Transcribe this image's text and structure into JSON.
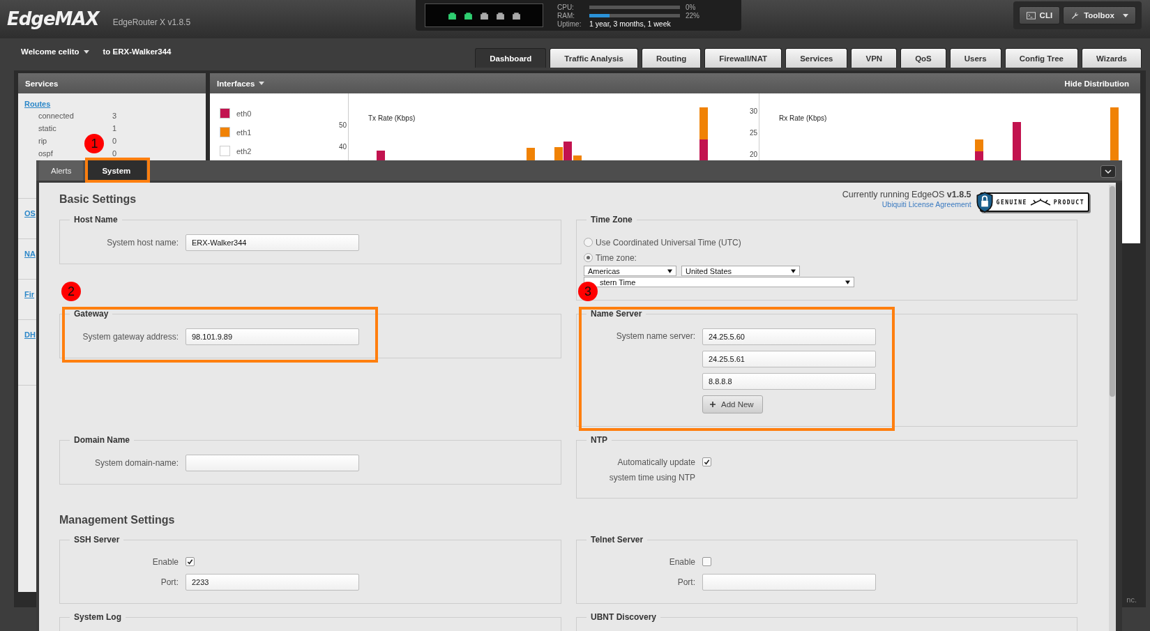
{
  "header": {
    "logo": "EdgeMAX",
    "model": "EdgeRouter X v1.8.5",
    "ports": [
      {
        "active": true
      },
      {
        "active": true
      },
      {
        "active": false
      },
      {
        "active": false
      },
      {
        "active": false
      }
    ],
    "meters": [
      {
        "label": "CPU:",
        "level": 0,
        "reading": "0%"
      },
      {
        "label": "RAM:",
        "level": 0.22,
        "reading": "22%"
      }
    ],
    "uptime": {
      "label": "Uptime:",
      "value": "1 year, 3 months, 1 week"
    },
    "buttons": [
      {
        "label": "CLI",
        "kind": "terminal"
      },
      {
        "label": "Toolbox",
        "kind": "wrench"
      }
    ]
  },
  "user": {
    "welcome": "Welcome celito",
    "target": "to ERX-Walker344"
  },
  "nav_tabs": [
    {
      "label": "Dashboard",
      "selected": true
    },
    {
      "label": "Traffic Analysis",
      "selected": false
    },
    {
      "label": "Routing",
      "selected": false
    },
    {
      "label": "Firewall/NAT",
      "selected": false
    },
    {
      "label": "Services",
      "selected": false
    },
    {
      "label": "VPN",
      "selected": false
    },
    {
      "label": "QoS",
      "selected": false
    },
    {
      "label": "Users",
      "selected": false
    },
    {
      "label": "Config Tree",
      "selected": false
    },
    {
      "label": "Wizards",
      "selected": false
    }
  ],
  "services_panel": {
    "title": "Services",
    "routes_link": "Routes",
    "routes": [
      {
        "name": "connected",
        "count": "3"
      },
      {
        "name": "static",
        "count": "1"
      },
      {
        "name": "rip",
        "count": "0"
      },
      {
        "name": "ospf",
        "count": "0"
      }
    ],
    "links": [
      "OS",
      "NA",
      "Fir",
      "DH"
    ]
  },
  "interfaces_panel": {
    "title": "Interfaces",
    "action": "Hide Distribution",
    "legend": [
      {
        "name": "eth0",
        "color": "#c2134f"
      },
      {
        "name": "eth1",
        "color": "#f08205"
      },
      {
        "name": "eth2",
        "color": "#ffffff"
      }
    ],
    "charts": [
      {
        "title": "Tx Rate (Kbps)",
        "ticks": [
          "50",
          "40"
        ]
      },
      {
        "title": "Rx Rate (Kbps)",
        "ticks": [
          "30",
          "25",
          "20"
        ]
      }
    ]
  },
  "footer_text": "nc.",
  "modal": {
    "tabs": [
      {
        "label": "Alerts",
        "selected": false,
        "highlighted": false
      },
      {
        "label": "System",
        "selected": true,
        "highlighted": true,
        "marker": "1"
      }
    ],
    "heading": "Basic Settings",
    "version_text": "Currently running EdgeOS **v1.8.5**",
    "license_link": "Ubiquiti License Agreement",
    "badge": {
      "left": "GENUINE",
      "right": "PRODUCT"
    },
    "basic_sections": [
      {
        "title": "Host Name",
        "highlighted": false,
        "fields": [
          {
            "kind": "text",
            "label": "System host name:",
            "value": "ERX-Walker344"
          }
        ]
      },
      {
        "title": "Time Zone",
        "highlighted": false,
        "fields": [
          {
            "kind": "radio",
            "label": "Use Coordinated Universal Time (UTC)",
            "selected": false
          },
          {
            "kind": "radio",
            "label": "Time zone:",
            "selected": true
          },
          {
            "kind": "selects",
            "values": [
              "Americas",
              "United States"
            ]
          },
          {
            "kind": "selects",
            "values": [
              "stern Time"
            ]
          }
        ]
      },
      {
        "title": "Gateway",
        "highlighted": true,
        "marker": "2",
        "fields": [
          {
            "kind": "text",
            "label": "System gateway address:",
            "value": "98.101.9.89"
          }
        ]
      },
      {
        "title": "Name Server",
        "highlighted": true,
        "marker": "3",
        "fields": [
          {
            "kind": "text_list",
            "label": "System name server:",
            "values": [
              "24.25.5.60",
              "24.25.5.61",
              "8.8.8.8"
            ],
            "button": "Add New"
          }
        ]
      },
      {
        "title": "Domain Name",
        "highlighted": false,
        "fields": [
          {
            "kind": "text",
            "label": "System domain-name:"
          }
        ]
      },
      {
        "title": "NTP",
        "highlighted": false,
        "fields": [
          {
            "kind": "checkbox",
            "label": "Automatically update system time using NTP",
            "checked": true
          }
        ]
      }
    ],
    "management_heading": "Management Settings",
    "management_sections": [
      {
        "title": "SSH Server",
        "highlighted": false,
        "fields": [
          {
            "kind": "checkbox",
            "label": "Enable",
            "checked": true
          },
          {
            "kind": "text",
            "label": "Port:",
            "value": "2233"
          }
        ]
      },
      {
        "title": "Telnet Server",
        "highlighted": false,
        "fields": [
          {
            "kind": "checkbox",
            "label": "Enable",
            "checked": false
          },
          {
            "kind": "text",
            "label": "Port:"
          }
        ]
      },
      {
        "title": "System Log",
        "highlighted": false
      },
      {
        "title": "UBNT Discovery",
        "highlighted": false
      }
    ]
  }
}
